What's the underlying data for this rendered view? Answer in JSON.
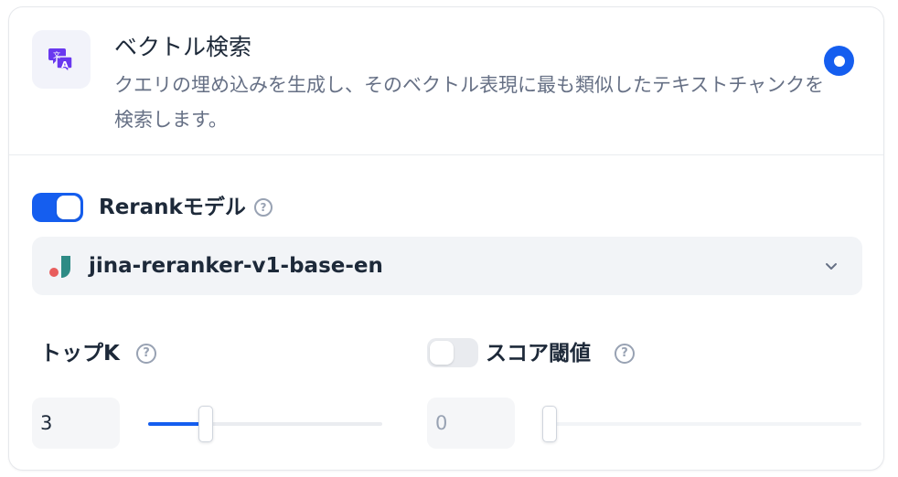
{
  "retrieval_method": {
    "title": "ベクトル検索",
    "description": "クエリの埋め込みを生成し、そのベクトル表現に最も類似したテキストチャンクを検索します。",
    "selected": true,
    "icon": "translate-icon"
  },
  "rerank": {
    "enabled": true,
    "label": "Rerankモデル",
    "help_icon": "question-circle-icon",
    "model_name": "jina-reranker-v1-base-en"
  },
  "top_k": {
    "label": "トップK",
    "value": "3",
    "slider_fraction": 0.22
  },
  "score_threshold": {
    "enabled": false,
    "label": "スコア閾値",
    "value": "0",
    "slider_fraction": 0.0
  },
  "colors": {
    "accent": "#155eef",
    "icon_purple": "#6938ef",
    "logo_red": "#e85d5d",
    "logo_teal": "#2e8b85"
  }
}
